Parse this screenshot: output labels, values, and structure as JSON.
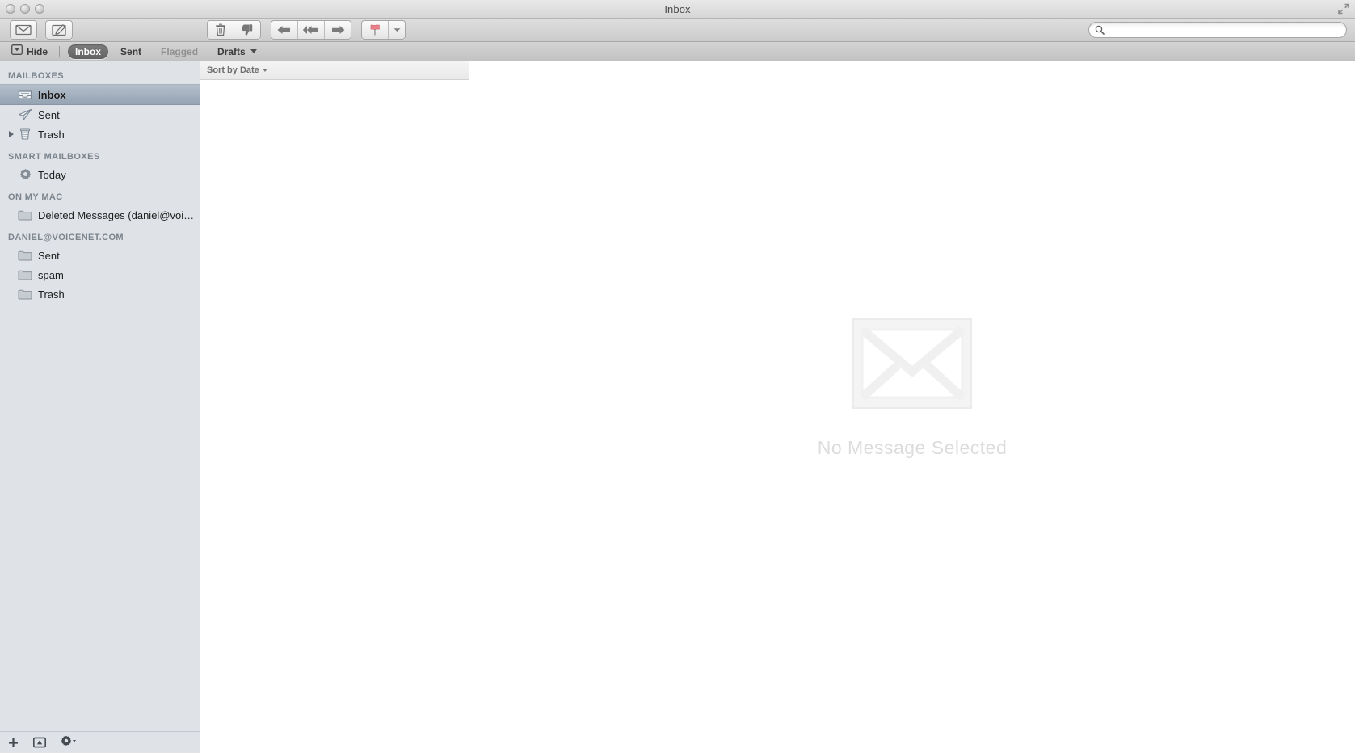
{
  "window": {
    "title": "Inbox",
    "traffic_lights": [
      "close",
      "minimize",
      "zoom"
    ],
    "fullscreen_icon": "fullscreen-arrows-icon"
  },
  "toolbar": {
    "left_buttons": [
      {
        "name": "get-mail-button",
        "icon": "envelope-icon",
        "label": "Get Mail"
      },
      {
        "name": "compose-button",
        "icon": "compose-pencil-icon",
        "label": "New Message"
      }
    ],
    "mid_groups": [
      {
        "name": "delete-junk-group",
        "buttons": [
          {
            "name": "delete-button",
            "icon": "trash-icon",
            "label": "Delete"
          },
          {
            "name": "junk-button",
            "icon": "thumbs-down-icon",
            "label": "Junk"
          }
        ]
      },
      {
        "name": "reply-group",
        "buttons": [
          {
            "name": "reply-button",
            "icon": "reply-arrow-icon",
            "label": "Reply"
          },
          {
            "name": "reply-all-button",
            "icon": "reply-all-arrow-icon",
            "label": "Reply All"
          },
          {
            "name": "forward-button",
            "icon": "forward-arrow-icon",
            "label": "Forward"
          }
        ]
      },
      {
        "name": "flag-group",
        "buttons": [
          {
            "name": "flag-button",
            "icon": "red-flag-icon",
            "label": "Flag"
          },
          {
            "name": "flag-dropdown-button",
            "icon": "chevron-down-icon",
            "label": "Flag options"
          }
        ]
      }
    ],
    "search": {
      "value": "",
      "placeholder": "",
      "icon": "search-icon"
    }
  },
  "favorites_bar": {
    "hide_icon": "sidebar-toggle-icon",
    "hide_label": "Hide",
    "items": [
      {
        "name": "fav-inbox",
        "label": "Inbox",
        "selected": true,
        "dim": false,
        "has_caret": false
      },
      {
        "name": "fav-sent",
        "label": "Sent",
        "selected": false,
        "dim": false,
        "has_caret": false
      },
      {
        "name": "fav-flagged",
        "label": "Flagged",
        "selected": false,
        "dim": true,
        "has_caret": false
      },
      {
        "name": "fav-drafts",
        "label": "Drafts",
        "selected": false,
        "dim": false,
        "has_caret": true
      }
    ]
  },
  "sidebar": {
    "sections": [
      {
        "name": "section-mailboxes",
        "header": "MAILBOXES",
        "rows": [
          {
            "name": "sidebar-item-inbox",
            "label": "Inbox",
            "icon": "inbox-tray-icon",
            "selected": true,
            "disclosure": false
          },
          {
            "name": "sidebar-item-sent",
            "label": "Sent",
            "icon": "paper-plane-icon",
            "selected": false,
            "disclosure": false
          },
          {
            "name": "sidebar-item-trash",
            "label": "Trash",
            "icon": "trash-can-icon",
            "selected": false,
            "disclosure": true
          }
        ]
      },
      {
        "name": "section-smart-mailboxes",
        "header": "SMART MAILBOXES",
        "rows": [
          {
            "name": "sidebar-item-today",
            "label": "Today",
            "icon": "gear-icon",
            "selected": false,
            "disclosure": false
          }
        ]
      },
      {
        "name": "section-on-my-mac",
        "header": "ON MY MAC",
        "rows": [
          {
            "name": "sidebar-item-deleted-messages",
            "label": "Deleted Messages (daniel@voic…",
            "icon": "folder-icon",
            "selected": false,
            "disclosure": false
          }
        ]
      },
      {
        "name": "section-daniel-voicenet",
        "header": "DANIEL@VOICENET.COM",
        "rows": [
          {
            "name": "sidebar-item-account-sent",
            "label": "Sent",
            "icon": "folder-icon",
            "selected": false,
            "disclosure": false
          },
          {
            "name": "sidebar-item-account-spam",
            "label": "spam",
            "icon": "folder-icon",
            "selected": false,
            "disclosure": false
          },
          {
            "name": "sidebar-item-account-trash",
            "label": "Trash",
            "icon": "folder-icon",
            "selected": false,
            "disclosure": false
          }
        ]
      }
    ],
    "footer_buttons": [
      {
        "name": "add-mailbox-button",
        "icon": "plus-icon",
        "label": "Add"
      },
      {
        "name": "mailbox-activity-button",
        "icon": "activity-icon",
        "label": "Activity"
      },
      {
        "name": "mailbox-actions-button",
        "icon": "gear-dropdown-icon",
        "label": "Actions"
      }
    ]
  },
  "message_list": {
    "sort_label": "Sort by Date",
    "sort_caret": "chevron-down-icon",
    "messages": []
  },
  "preview": {
    "empty_icon": "large-envelope-icon",
    "empty_text": "No Message Selected"
  },
  "colors": {
    "sidebar_bg": "#dfe3e8",
    "selected_row": "#95a3b3",
    "toolbar_bg": "#cbcbcb",
    "flag_red": "#e8737d",
    "empty_text": "#dcdcdc"
  }
}
